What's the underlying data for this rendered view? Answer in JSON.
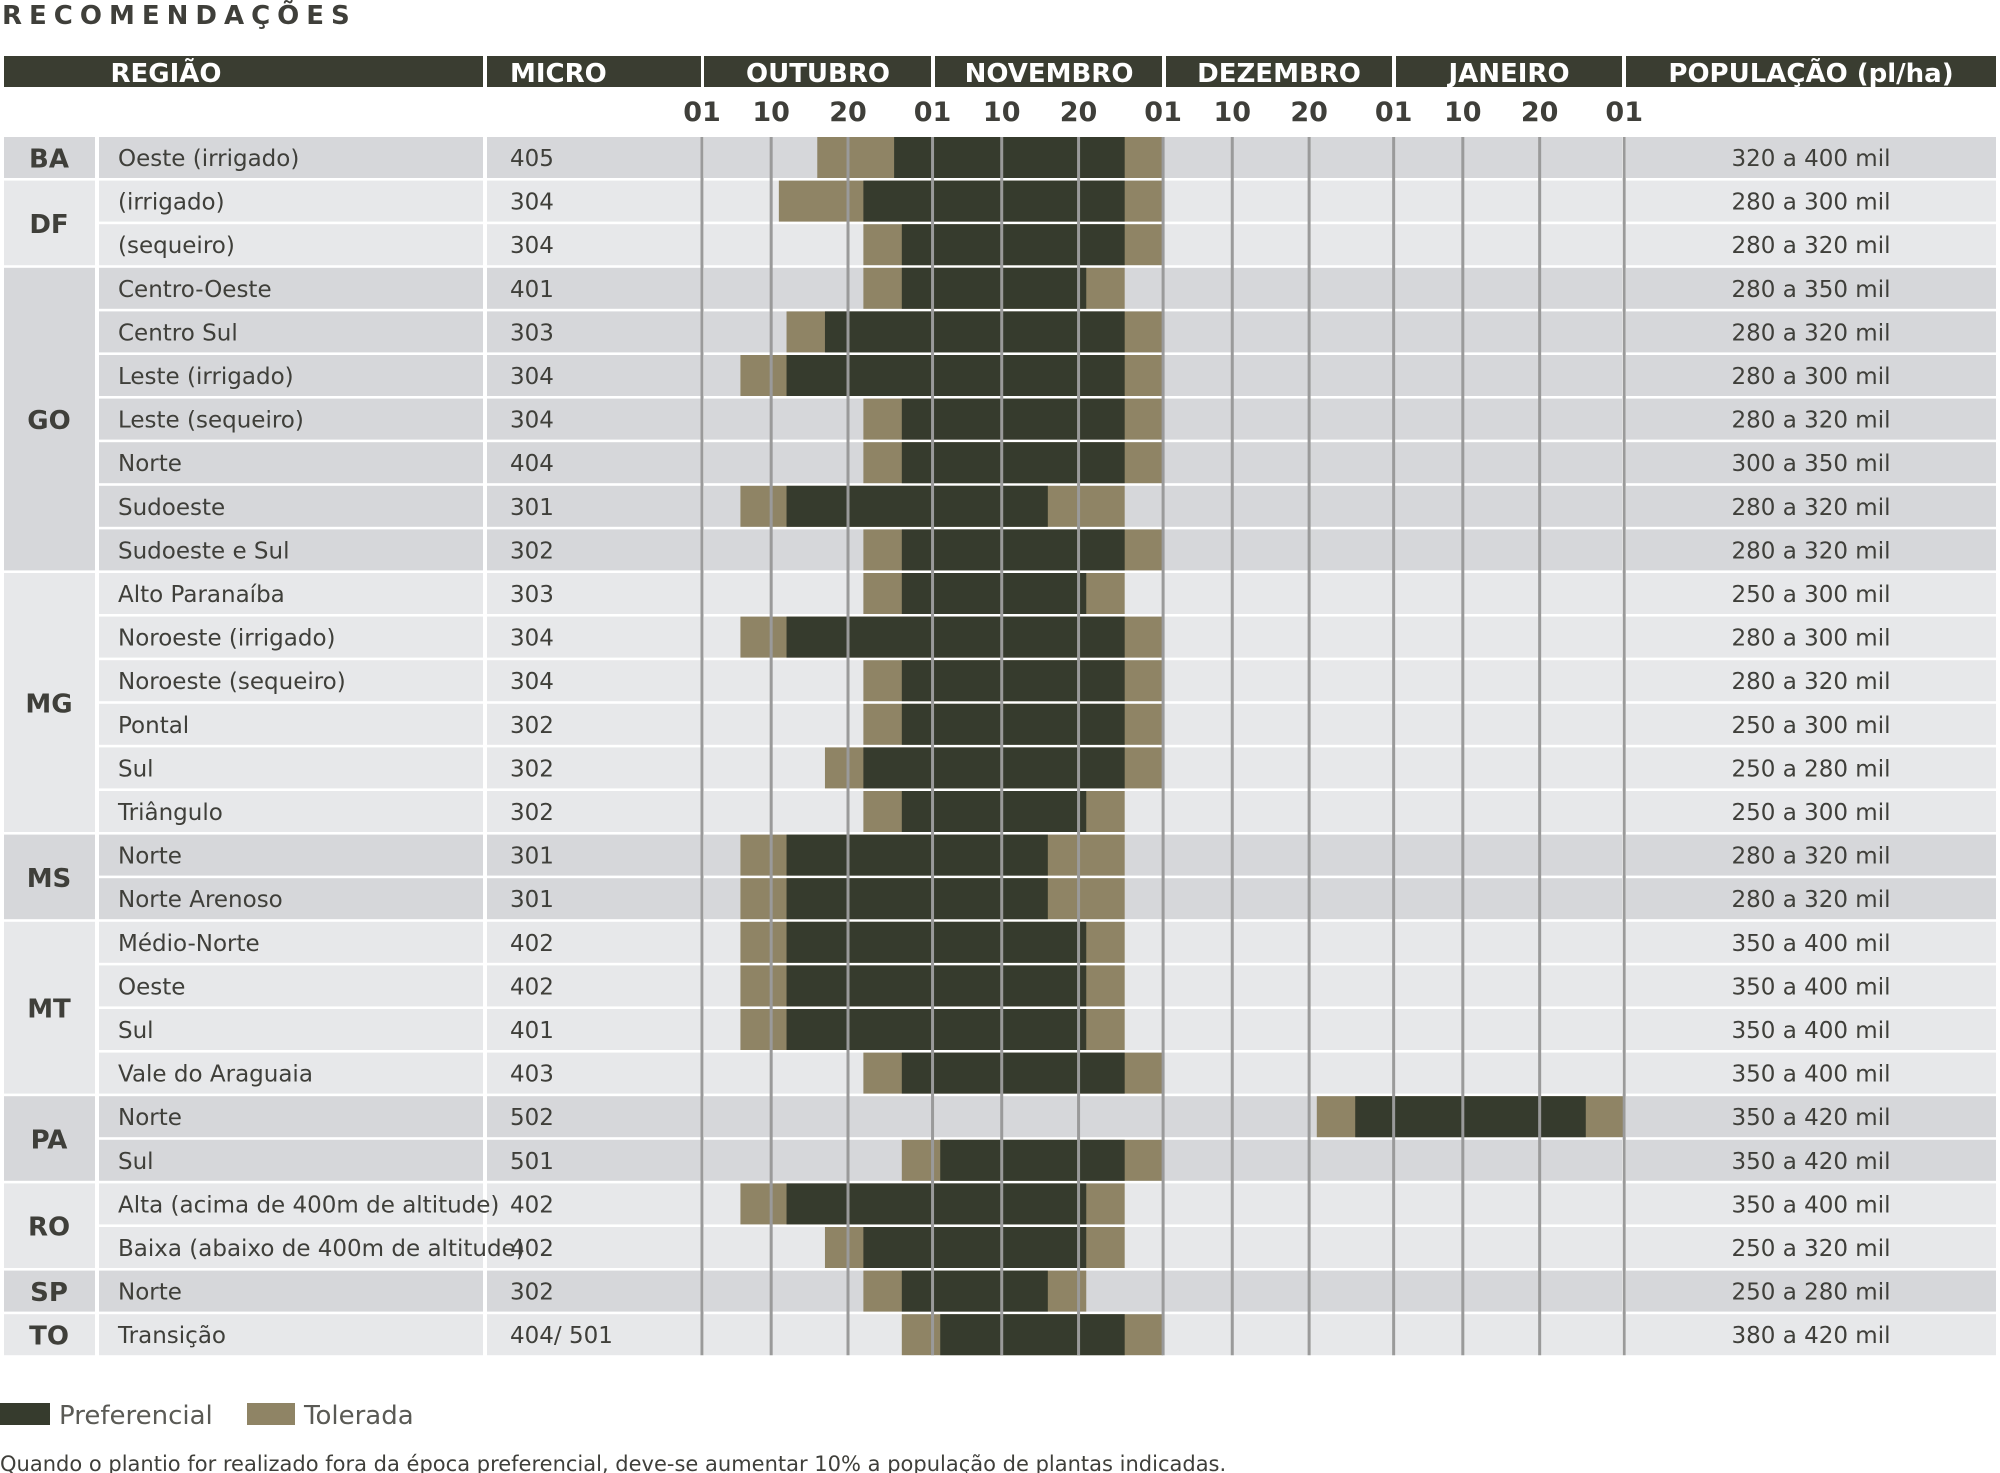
{
  "title": "RECOMENDAÇÕES",
  "headers": {
    "regiao": "REGIÃO",
    "micro": "MICRO",
    "months": [
      "OUTUBRO",
      "NOVEMBRO",
      "DEZEMBRO",
      "JANEIRO"
    ],
    "populacao": "POPULAÇÃO (pl/ha)"
  },
  "day_ticks": [
    "01",
    "10",
    "20",
    "01",
    "10",
    "20",
    "01",
    "10",
    "20",
    "01",
    "10",
    "20",
    "01"
  ],
  "legend": {
    "preferencial": "Preferencial",
    "tolerada": "Tolerada"
  },
  "note": "Quando o plantio for realizado fora da época preferencial, deve-se aumentar 10% a população de plantas indicadas.",
  "colors": {
    "header": "#3a3d31",
    "preferencial": "#363b2d",
    "tolerada": "#8f8465",
    "row_dark": "#d6d7da",
    "row_light": "#e7e8ea",
    "state_cell": "#d6d7da",
    "grid_line": "#9a9a9a"
  },
  "chart_data": {
    "type": "gantt",
    "title": "RECOMENDAÇÕES",
    "time_axis": "days counted from 01 Oct (0 = 01 Oct, 30 = 01 Nov, 60 = 01 Dez, 90 = 01 Jan, 120 = 01 Fev)",
    "series": [
      "Preferencial",
      "Tolerada"
    ],
    "groups": [
      {
        "state": "BA",
        "rows": [
          {
            "region": "Oeste (irrigado)",
            "micro": "405",
            "population": "320 a 400 mil",
            "tolerated": [
              [
                15,
                60
              ]
            ],
            "preferred": [
              [
                25,
                55
              ]
            ]
          }
        ]
      },
      {
        "state": "DF",
        "rows": [
          {
            "region": "(irrigado)",
            "micro": "304",
            "population": "280 a 300 mil",
            "tolerated": [
              [
                10,
                60
              ]
            ],
            "preferred": [
              [
                21,
                55
              ]
            ]
          },
          {
            "region": "(sequeiro)",
            "micro": "304",
            "population": "280 a 320 mil",
            "tolerated": [
              [
                21,
                60
              ]
            ],
            "preferred": [
              [
                26,
                55
              ]
            ]
          }
        ]
      },
      {
        "state": "GO",
        "rows": [
          {
            "region": "Centro-Oeste",
            "micro": "401",
            "population": "280 a 350 mil",
            "tolerated": [
              [
                21,
                55
              ]
            ],
            "preferred": [
              [
                26,
                50
              ]
            ]
          },
          {
            "region": "Centro Sul",
            "micro": "303",
            "population": "280 a 320 mil",
            "tolerated": [
              [
                11,
                60
              ]
            ],
            "preferred": [
              [
                16,
                55
              ]
            ]
          },
          {
            "region": "Leste (irrigado)",
            "micro": "304",
            "population": "280 a 300 mil",
            "tolerated": [
              [
                5,
                60
              ]
            ],
            "preferred": [
              [
                11,
                55
              ]
            ]
          },
          {
            "region": "Leste (sequeiro)",
            "micro": "304",
            "population": "280 a 320 mil",
            "tolerated": [
              [
                21,
                60
              ]
            ],
            "preferred": [
              [
                26,
                55
              ]
            ]
          },
          {
            "region": "Norte",
            "micro": "404",
            "population": "300 a 350 mil",
            "tolerated": [
              [
                21,
                60
              ]
            ],
            "preferred": [
              [
                26,
                55
              ]
            ]
          },
          {
            "region": "Sudoeste",
            "micro": "301",
            "population": "280 a 320 mil",
            "tolerated": [
              [
                5,
                55
              ]
            ],
            "preferred": [
              [
                11,
                45
              ]
            ]
          },
          {
            "region": "Sudoeste e Sul",
            "micro": "302",
            "population": "280 a 320 mil",
            "tolerated": [
              [
                21,
                60
              ]
            ],
            "preferred": [
              [
                26,
                55
              ]
            ]
          }
        ]
      },
      {
        "state": "MG",
        "rows": [
          {
            "region": "Alto Paranaíba",
            "micro": "303",
            "population": "250 a 300 mil",
            "tolerated": [
              [
                21,
                55
              ]
            ],
            "preferred": [
              [
                26,
                50
              ]
            ]
          },
          {
            "region": "Noroeste (irrigado)",
            "micro": "304",
            "population": "280 a 300 mil",
            "tolerated": [
              [
                5,
                60
              ]
            ],
            "preferred": [
              [
                11,
                55
              ]
            ]
          },
          {
            "region": "Noroeste (sequeiro)",
            "micro": "304",
            "population": "280 a 320 mil",
            "tolerated": [
              [
                21,
                60
              ]
            ],
            "preferred": [
              [
                26,
                55
              ]
            ]
          },
          {
            "region": "Pontal",
            "micro": "302",
            "population": "250 a 300 mil",
            "tolerated": [
              [
                21,
                60
              ]
            ],
            "preferred": [
              [
                26,
                55
              ]
            ]
          },
          {
            "region": "Sul",
            "micro": "302",
            "population": "250 a 280 mil",
            "tolerated": [
              [
                16,
                60
              ]
            ],
            "preferred": [
              [
                21,
                55
              ]
            ]
          },
          {
            "region": "Triângulo",
            "micro": "302",
            "population": "250 a 300 mil",
            "tolerated": [
              [
                21,
                55
              ]
            ],
            "preferred": [
              [
                26,
                50
              ]
            ]
          }
        ]
      },
      {
        "state": "MS",
        "rows": [
          {
            "region": "Norte",
            "micro": "301",
            "population": "280 a 320 mil",
            "tolerated": [
              [
                5,
                55
              ]
            ],
            "preferred": [
              [
                11,
                45
              ]
            ]
          },
          {
            "region": "Norte Arenoso",
            "micro": "301",
            "population": "280 a 320 mil",
            "tolerated": [
              [
                5,
                55
              ]
            ],
            "preferred": [
              [
                11,
                45
              ]
            ]
          }
        ]
      },
      {
        "state": "MT",
        "rows": [
          {
            "region": "Médio-Norte",
            "micro": "402",
            "population": "350 a 400 mil",
            "tolerated": [
              [
                5,
                55
              ]
            ],
            "preferred": [
              [
                11,
                50
              ]
            ]
          },
          {
            "region": "Oeste",
            "micro": "402",
            "population": "350 a 400 mil",
            "tolerated": [
              [
                5,
                55
              ]
            ],
            "preferred": [
              [
                11,
                50
              ]
            ]
          },
          {
            "region": "Sul",
            "micro": "401",
            "population": "350 a 400 mil",
            "tolerated": [
              [
                5,
                55
              ]
            ],
            "preferred": [
              [
                11,
                50
              ]
            ]
          },
          {
            "region": "Vale do Araguaia",
            "micro": "403",
            "population": "350 a 400 mil",
            "tolerated": [
              [
                21,
                60
              ]
            ],
            "preferred": [
              [
                26,
                55
              ]
            ]
          }
        ]
      },
      {
        "state": "PA",
        "rows": [
          {
            "region": "Norte",
            "micro": "502",
            "population": "350 a 420 mil",
            "tolerated": [
              [
                80,
                120
              ]
            ],
            "preferred": [
              [
                85,
                115
              ]
            ]
          },
          {
            "region": "Sul",
            "micro": "501",
            "population": "350 a 420 mil",
            "tolerated": [
              [
                26,
                60
              ]
            ],
            "preferred": [
              [
                31,
                55
              ]
            ]
          }
        ]
      },
      {
        "state": "RO",
        "rows": [
          {
            "region": "Alta (acima de 400m de altitude)",
            "micro": "402",
            "population": "350 a 400 mil",
            "tolerated": [
              [
                5,
                55
              ]
            ],
            "preferred": [
              [
                11,
                50
              ]
            ]
          },
          {
            "region": "Baixa (abaixo de 400m de altitude)",
            "micro": "402",
            "population": "250 a 320 mil",
            "tolerated": [
              [
                16,
                55
              ]
            ],
            "preferred": [
              [
                21,
                50
              ]
            ]
          }
        ]
      },
      {
        "state": "SP",
        "rows": [
          {
            "region": "Norte",
            "micro": "302",
            "population": "250 a 280 mil",
            "tolerated": [
              [
                21,
                50
              ]
            ],
            "preferred": [
              [
                26,
                45
              ]
            ]
          }
        ]
      },
      {
        "state": "TO",
        "rows": [
          {
            "region": "Transição",
            "micro": "404/ 501",
            "population": "380 a 420 mil",
            "tolerated": [
              [
                26,
                60
              ]
            ],
            "preferred": [
              [
                31,
                55
              ]
            ]
          }
        ]
      }
    ]
  }
}
